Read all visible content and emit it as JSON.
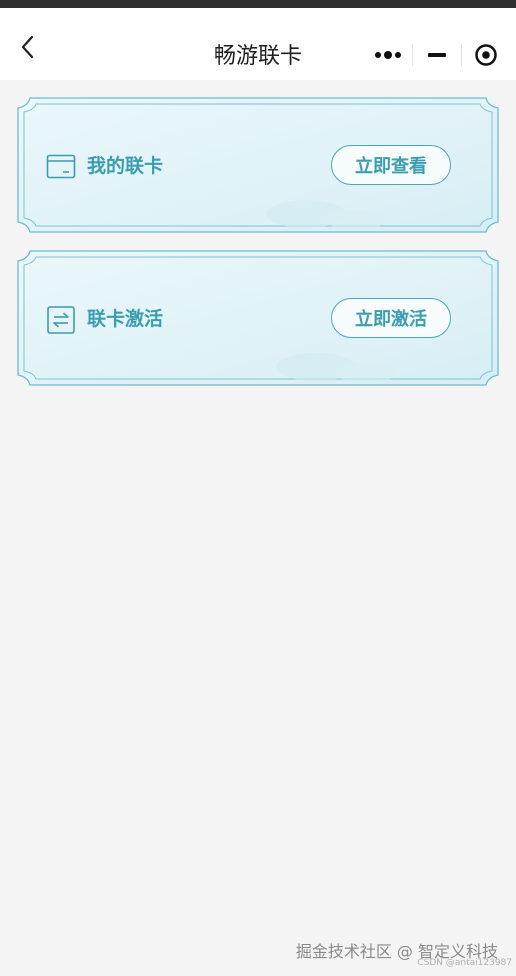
{
  "nav": {
    "title": "畅游联卡"
  },
  "cards": [
    {
      "label": "我的联卡",
      "button": "立即查看",
      "icon": "card-icon"
    },
    {
      "label": "联卡激活",
      "button": "立即激活",
      "icon": "exchange-icon"
    }
  ],
  "watermark": {
    "main": "掘金技术社区 @ 智定义科技",
    "sub": "CSDN @antai123987"
  },
  "colors": {
    "accent": "#3a9db0",
    "card_bg": "#e6f5f9",
    "card_border": "#6cbccd"
  }
}
